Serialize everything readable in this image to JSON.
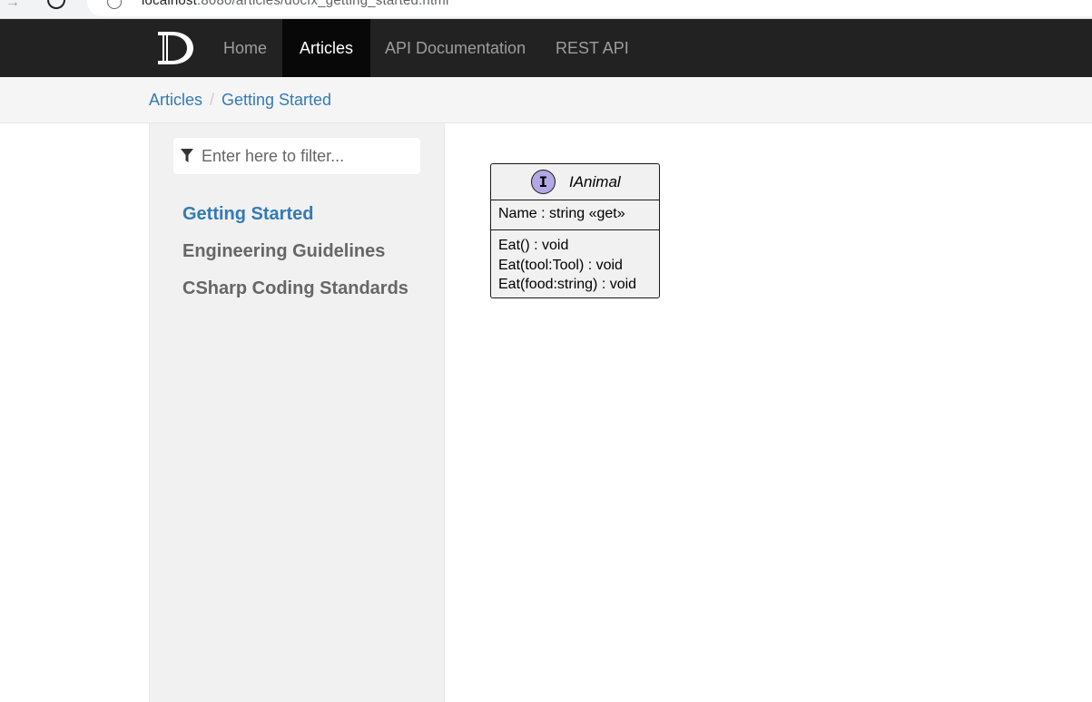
{
  "browser": {
    "url_host": "localhost",
    "url_rest": ":8080/articles/docfx_getting_started.html"
  },
  "navbar": {
    "logo_icon": "docfx-logo-icon",
    "items": [
      {
        "label": "Home",
        "active": false
      },
      {
        "label": "Articles",
        "active": true
      },
      {
        "label": "API Documentation",
        "active": false
      },
      {
        "label": "REST API",
        "active": false
      }
    ]
  },
  "breadcrumb": {
    "items": [
      "Articles",
      "Getting Started"
    ],
    "separator": "/"
  },
  "sidebar": {
    "filter_icon": "filter-icon",
    "filter_placeholder": "Enter here to filter...",
    "toc": [
      {
        "label": "Getting Started",
        "active": true
      },
      {
        "label": "Engineering Guidelines",
        "active": false
      },
      {
        "label": "CSharp Coding Standards",
        "active": false
      }
    ]
  },
  "diagram": {
    "class_marker": "I",
    "class_name": "IAnimal",
    "fields": [
      "Name : string «get»"
    ],
    "methods": [
      "Eat() : void",
      "Eat(tool:Tool) : void",
      "Eat(food:string) : void"
    ]
  },
  "colors": {
    "navbar_bg": "#222222",
    "nav_active_bg": "#080808",
    "link": "#337ab7",
    "interface_circle": "#b4a7e5"
  }
}
